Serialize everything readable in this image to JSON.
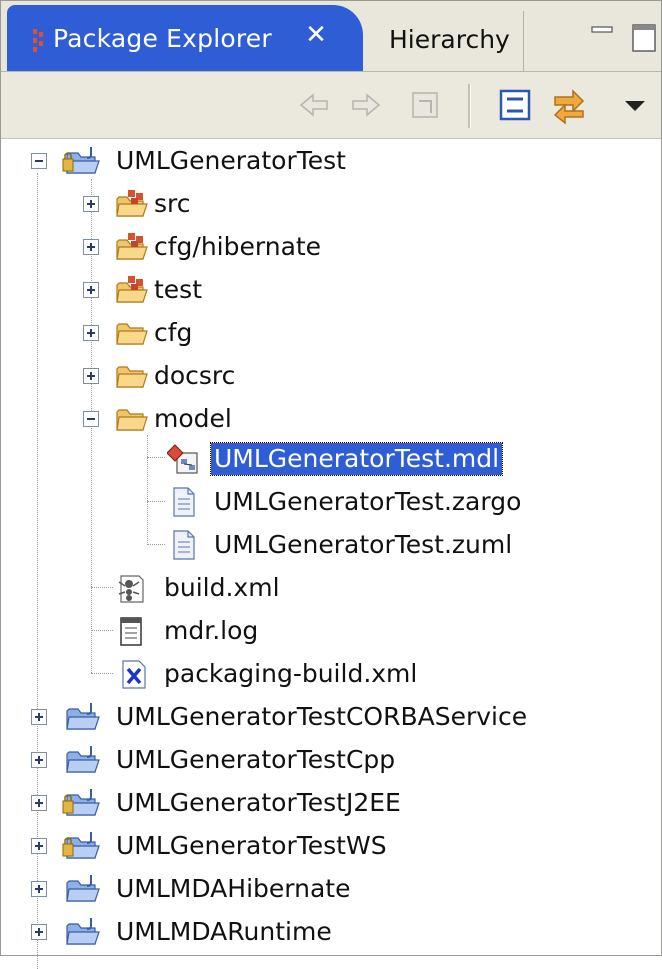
{
  "view": {
    "active_tab": {
      "label": "Package Explorer",
      "icon": "package-explorer-icon",
      "close_glyph": "✕"
    },
    "inactive_tab": {
      "label": "Hierarchy"
    },
    "window_controls": [
      "minimize-icon",
      "maximize-icon"
    ]
  },
  "toolbar": {
    "buttons": [
      "back-icon",
      "forward-icon",
      "go-into-icon",
      "collapse-all-icon",
      "link-with-editor-icon",
      "view-menu-icon"
    ]
  },
  "tree": {
    "project_root": "UMLGeneratorTest",
    "children": {
      "src": "src",
      "cfg_hibernate": "cfg/hibernate",
      "test": "test",
      "cfg": "cfg",
      "docsrc": "docsrc",
      "model": "model",
      "model_files": [
        "UMLGeneratorTest.mdl",
        "UMLGeneratorTest.zargo",
        "UMLGeneratorTest.zuml"
      ],
      "build_xml": "build.xml",
      "mdr_log": "mdr.log",
      "packaging_build": "packaging-build.xml"
    },
    "other_projects": [
      "UMLGeneratorTestCORBAService",
      "UMLGeneratorTestCpp",
      "UMLGeneratorTestJ2EE",
      "UMLGeneratorTestWS",
      "UMLMDAHibernate",
      "UMLMDARuntime"
    ],
    "selected": "UMLGeneratorTest.mdl"
  },
  "colors": {
    "selection": "#2f5dd6",
    "tab_active": "#2f5dd6",
    "folder": "#e8b04a",
    "toolbar_bg": "#ebe8de"
  }
}
